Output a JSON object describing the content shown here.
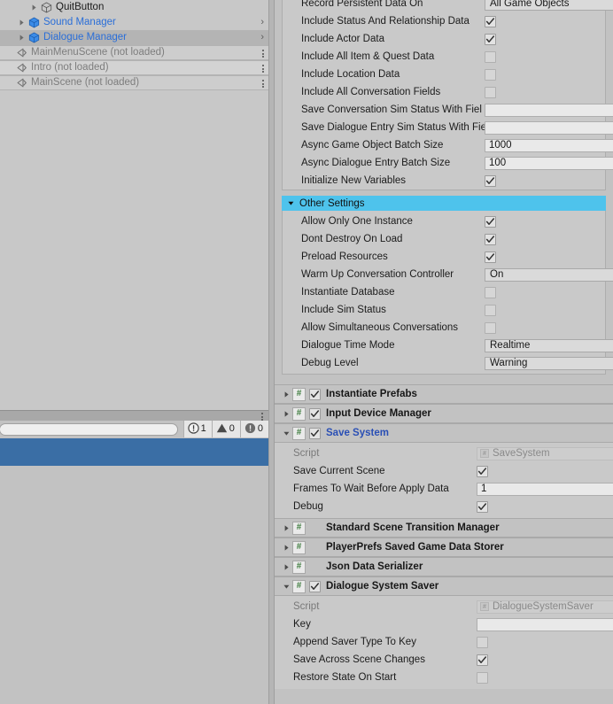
{
  "hierarchy": {
    "name": "Hierarchy",
    "rows": [
      {
        "label": "QuitButton",
        "kind": "gameobject",
        "indent": 2,
        "arrow": "right",
        "style": "plain",
        "right": "none"
      },
      {
        "label": "Sound Manager",
        "kind": "prefab",
        "indent": 1,
        "arrow": "right",
        "style": "prefab",
        "right": "chevron"
      },
      {
        "label": "Dialogue Manager",
        "kind": "prefab",
        "indent": 1,
        "arrow": "right",
        "style": "prefab",
        "right": "chevron",
        "selected": true
      },
      {
        "label": "MainMenuScene (not loaded)",
        "kind": "scene",
        "indent": 0,
        "arrow": "none",
        "style": "unloaded",
        "right": "kebab"
      },
      {
        "label": "Intro (not loaded)",
        "kind": "scene",
        "indent": 0,
        "arrow": "none",
        "style": "unloaded",
        "right": "kebab"
      },
      {
        "label": "MainScene (not loaded)",
        "kind": "scene",
        "indent": 0,
        "arrow": "none",
        "style": "unloaded",
        "right": "kebab"
      }
    ]
  },
  "console": {
    "name": "Console",
    "search_value": "",
    "search_placeholder": "",
    "counters": [
      {
        "icon": "error-icon",
        "count": "1"
      },
      {
        "icon": "warning-icon",
        "count": "0"
      },
      {
        "icon": "info-icon",
        "count": "0"
      }
    ]
  },
  "inspector": {
    "persistent_data_settings": {
      "rows": [
        {
          "label": "Record Persistent Data On",
          "type": "popup",
          "value": "All Game Objects"
        },
        {
          "label": "Include Status And Relationship Data",
          "type": "checkbox",
          "value": true
        },
        {
          "label": "Include Actor Data",
          "type": "checkbox",
          "value": true
        },
        {
          "label": "Include All Item & Quest Data",
          "type": "checkbox",
          "value": false
        },
        {
          "label": "Include Location Data",
          "type": "checkbox",
          "value": false
        },
        {
          "label": "Include All Conversation Fields",
          "type": "checkbox",
          "value": false
        },
        {
          "label": "Save Conversation Sim Status With Fiel",
          "type": "text",
          "value": ""
        },
        {
          "label": "Save Dialogue Entry Sim Status With Fie",
          "type": "text",
          "value": ""
        },
        {
          "label": "Async Game Object Batch Size",
          "type": "text",
          "value": "1000"
        },
        {
          "label": "Async Dialogue Entry Batch Size",
          "type": "text",
          "value": "100"
        },
        {
          "label": "Initialize New Variables",
          "type": "checkbox",
          "value": true
        }
      ]
    },
    "other_settings": {
      "header": "Other Settings",
      "expanded": true,
      "rows": [
        {
          "label": "Allow Only One Instance",
          "type": "checkbox",
          "value": true
        },
        {
          "label": "Dont Destroy On Load",
          "type": "checkbox",
          "value": true
        },
        {
          "label": "Preload Resources",
          "type": "checkbox",
          "value": true
        },
        {
          "label": "Warm Up Conversation Controller",
          "type": "popup",
          "value": "On"
        },
        {
          "label": "Instantiate Database",
          "type": "checkbox",
          "value": false
        },
        {
          "label": "Include Sim Status",
          "type": "checkbox",
          "value": false
        },
        {
          "label": "Allow Simultaneous Conversations",
          "type": "checkbox",
          "value": false
        },
        {
          "label": "Dialogue Time Mode",
          "type": "popup",
          "value": "Realtime"
        },
        {
          "label": "Debug Level",
          "type": "popup",
          "value": "Warning"
        }
      ]
    },
    "components": [
      {
        "title": "Instantiate Prefabs",
        "expanded": false,
        "enabled": true,
        "has_toggle": true,
        "title_selected": false,
        "rows": []
      },
      {
        "title": "Input Device Manager",
        "expanded": false,
        "enabled": true,
        "has_toggle": true,
        "title_selected": false,
        "rows": []
      },
      {
        "title": "Save System",
        "expanded": true,
        "enabled": true,
        "has_toggle": true,
        "title_selected": true,
        "rows": [
          {
            "label": "Script",
            "type": "object",
            "value": "SaveSystem",
            "disabled": true
          },
          {
            "label": "Save Current Scene",
            "type": "checkbox",
            "value": true
          },
          {
            "label": "Frames To Wait Before Apply Data",
            "type": "text",
            "value": "1"
          },
          {
            "label": "Debug",
            "type": "checkbox",
            "value": true
          }
        ]
      },
      {
        "title": "Standard Scene Transition Manager",
        "expanded": false,
        "enabled": false,
        "has_toggle": false,
        "title_selected": false,
        "rows": []
      },
      {
        "title": "PlayerPrefs Saved Game Data Storer",
        "expanded": false,
        "enabled": false,
        "has_toggle": false,
        "title_selected": false,
        "rows": []
      },
      {
        "title": "Json Data Serializer",
        "expanded": false,
        "enabled": false,
        "has_toggle": false,
        "title_selected": false,
        "rows": []
      },
      {
        "title": "Dialogue System Saver",
        "expanded": true,
        "enabled": true,
        "has_toggle": true,
        "title_selected": false,
        "rows": [
          {
            "label": "Script",
            "type": "object",
            "value": "DialogueSystemSaver",
            "disabled": true
          },
          {
            "label": "Key",
            "type": "text",
            "value": ""
          },
          {
            "label": "Append Saver Type To Key",
            "type": "checkbox",
            "value": false
          },
          {
            "label": "Save Across Scene Changes",
            "type": "checkbox",
            "value": true
          },
          {
            "label": "Restore State On Start",
            "type": "checkbox",
            "value": false
          }
        ]
      }
    ],
    "script_icon_glyph": "#"
  },
  "colors": {
    "panel_bg": "#c2c2c2",
    "inset_bg": "#c9c9c9",
    "foldout_highlight": "#4ec3ec",
    "selection_blue": "#3a6ea5",
    "prefab_blue": "#2a6ed8",
    "component_title_selected": "#2a4fb5",
    "script_icon_green": "#3f7d3f",
    "disabled_text": "#8a8a8a"
  }
}
